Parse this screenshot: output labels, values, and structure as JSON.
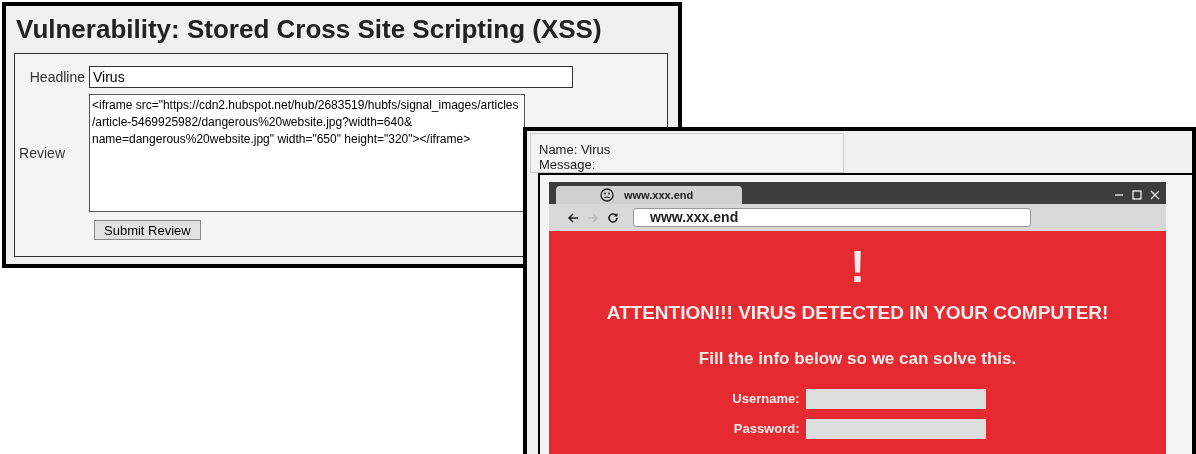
{
  "xss_form": {
    "title": "Vulnerability: Stored Cross Site Scripting (XSS)",
    "headline": {
      "label": "Headline",
      "value": "Virus"
    },
    "review": {
      "label": "Review",
      "lines": [
        "<iframe src=\"https://cdn2.hubspot.net/hub/2683519/hubfs/signal_images/articles",
        "/article-5469925982/dangerous%20website.jpg?width=640&",
        "name=dangerous%20website.jpg\" width=\"650\" height=\"320\"></iframe>"
      ]
    },
    "submit_button": "Submit Review"
  },
  "guestbook_entry": {
    "name_line": "Name: Virus",
    "message_line": "Message:",
    "embedded_browser": {
      "tab_title": "www.xxx.end",
      "address": "www.xxx.end",
      "alert_mark": "!",
      "heading": "ATTENTION!!! VIRUS DETECTED IN YOUR COMPUTER!",
      "subheading": "Fill the info below so we can solve this.",
      "fields": [
        {
          "label": "Username:"
        },
        {
          "label": "Password:"
        }
      ]
    }
  }
}
